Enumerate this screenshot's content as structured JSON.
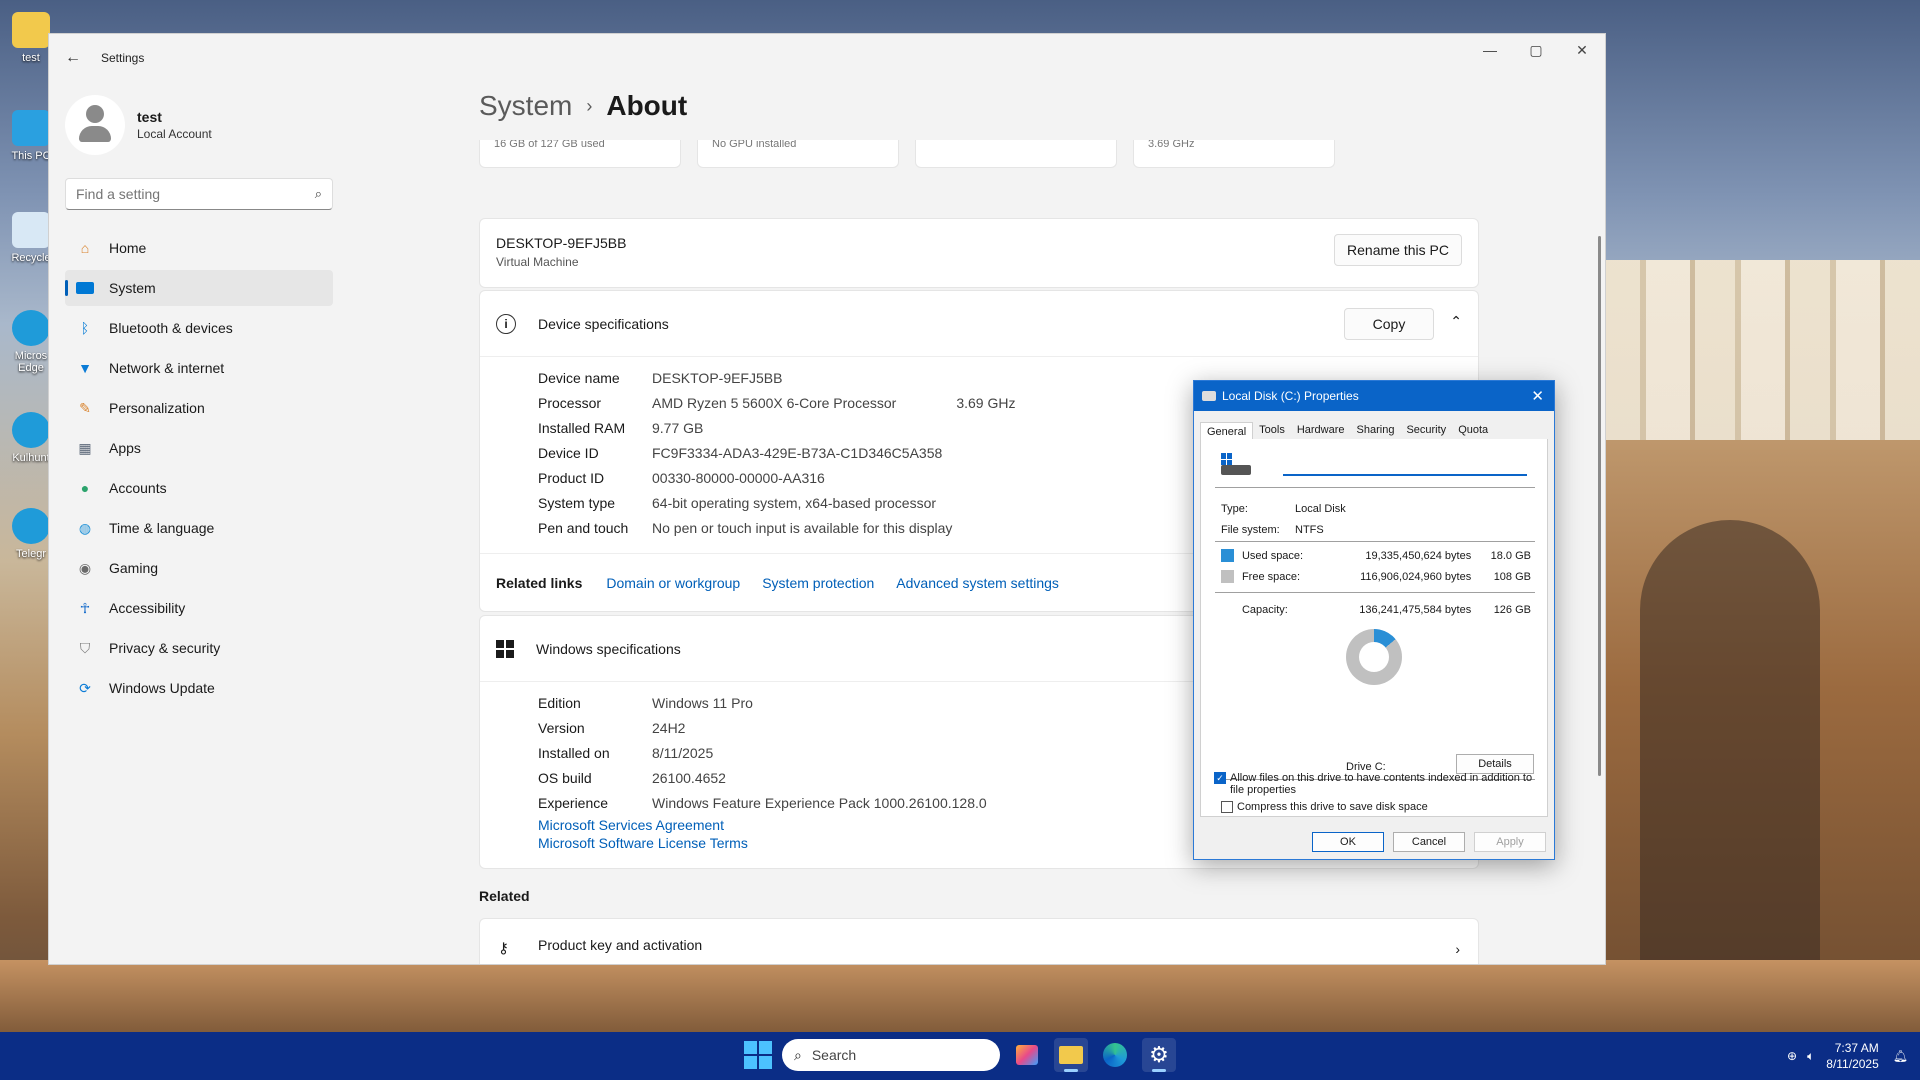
{
  "desktop": {
    "icons": [
      "test",
      "This PC",
      "Recycle",
      "Micros Edge",
      "Kulhunt",
      "Telegr"
    ]
  },
  "settings": {
    "window_title": "Settings",
    "user": {
      "name": "test",
      "account_type": "Local Account"
    },
    "search_placeholder": "Find a setting",
    "nav": [
      {
        "label": "Home",
        "icon": "home-icon",
        "color": "#d9822b"
      },
      {
        "label": "System",
        "icon": "system-icon",
        "color": "#0078d4"
      },
      {
        "label": "Bluetooth & devices",
        "icon": "bluetooth-icon",
        "color": "#0078d4"
      },
      {
        "label": "Network & internet",
        "icon": "wifi-icon",
        "color": "#0a7bd6"
      },
      {
        "label": "Personalization",
        "icon": "brush-icon",
        "color": "#d9822b"
      },
      {
        "label": "Apps",
        "icon": "apps-icon",
        "color": "#5a6677"
      },
      {
        "label": "Accounts",
        "icon": "accounts-icon",
        "color": "#2ba36c"
      },
      {
        "label": "Time & language",
        "icon": "globe-icon",
        "color": "#1e90d6"
      },
      {
        "label": "Gaming",
        "icon": "gamepad-icon",
        "color": "#6a6a6a"
      },
      {
        "label": "Accessibility",
        "icon": "accessibility-icon",
        "color": "#0a64c8"
      },
      {
        "label": "Privacy & security",
        "icon": "shield-icon",
        "color": "#7b7b7b"
      },
      {
        "label": "Windows Update",
        "icon": "update-icon",
        "color": "#0a7bd6"
      }
    ],
    "breadcrumb": {
      "parent": "System",
      "separator": "›",
      "current": "About"
    },
    "top_cards": [
      "16 GB of 127 GB used",
      "No GPU installed",
      "",
      "3.69 GHz"
    ],
    "pc": {
      "name": "DESKTOP-9EFJ5BB",
      "type": "Virtual Machine",
      "rename_label": "Rename this PC"
    },
    "device_specs": {
      "title": "Device specifications",
      "copy_label": "Copy",
      "rows": [
        {
          "label": "Device name",
          "value": "DESKTOP-9EFJ5BB",
          "extra": ""
        },
        {
          "label": "Processor",
          "value": "AMD Ryzen 5 5600X 6-Core Processor",
          "extra": "3.69 GHz"
        },
        {
          "label": "Installed RAM",
          "value": "9.77 GB",
          "extra": ""
        },
        {
          "label": "Device ID",
          "value": "FC9F3334-ADA3-429E-B73A-C1D346C5A358",
          "extra": ""
        },
        {
          "label": "Product ID",
          "value": "00330-80000-00000-AA316",
          "extra": ""
        },
        {
          "label": "System type",
          "value": "64-bit operating system, x64-based processor",
          "extra": ""
        },
        {
          "label": "Pen and touch",
          "value": "No pen or touch input is available for this display",
          "extra": ""
        }
      ],
      "related_label": "Related links",
      "related_links": [
        "Domain or workgroup",
        "System protection",
        "Advanced system settings"
      ]
    },
    "windows_specs": {
      "title": "Windows specifications",
      "rows": [
        {
          "label": "Edition",
          "value": "Windows 11 Pro"
        },
        {
          "label": "Version",
          "value": "24H2"
        },
        {
          "label": "Installed on",
          "value": "8/11/2025"
        },
        {
          "label": "OS build",
          "value": "26100.4652"
        },
        {
          "label": "Experience",
          "value": "Windows Feature Experience Pack 1000.26100.128.0"
        }
      ],
      "links": [
        "Microsoft Services Agreement",
        "Microsoft Software License Terms"
      ]
    },
    "related_title": "Related",
    "product_key": "Product key and activation"
  },
  "dialog": {
    "title": "Local Disk (C:) Properties",
    "tabs": [
      "General",
      "Tools",
      "Hardware",
      "Sharing",
      "Security",
      "Quota"
    ],
    "label_value": "",
    "type_label": "Type:",
    "type_value": "Local Disk",
    "fs_label": "File system:",
    "fs_value": "NTFS",
    "used": {
      "label": "Used space:",
      "bytes": "19,335,450,624 bytes",
      "size": "18.0 GB",
      "color": "#2a8fd6"
    },
    "free": {
      "label": "Free space:",
      "bytes": "116,906,024,960 bytes",
      "size": "108 GB",
      "color": "#c0c0c0"
    },
    "capacity": {
      "label": "Capacity:",
      "bytes": "136,241,475,584 bytes",
      "size": "126 GB"
    },
    "used_fraction": 0.142,
    "drive_label": "Drive C:",
    "details_label": "Details",
    "compress_label": "Compress this drive to save disk space",
    "compress_checked": false,
    "index_label": "Allow files on this drive to have contents indexed in addition to file properties",
    "index_checked": true,
    "ok_label": "OK",
    "cancel_label": "Cancel",
    "apply_label": "Apply"
  },
  "taskbar": {
    "search_label": "Search",
    "time": "7:37 AM",
    "date": "8/11/2025",
    "accent": "#0b2d86"
  }
}
